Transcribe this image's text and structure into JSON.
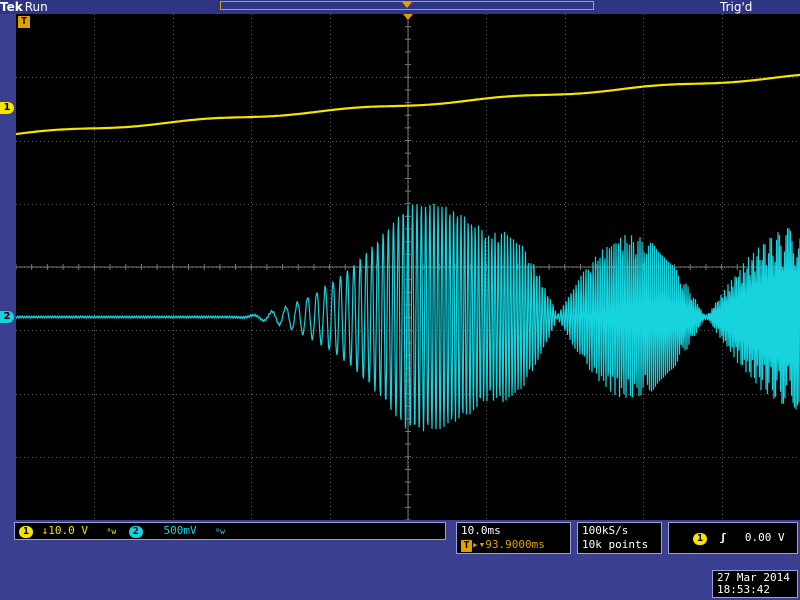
{
  "header": {
    "brand": "Tek",
    "state": "Run",
    "trigger_status": "Trig'd"
  },
  "markers": {
    "trigger_marker": "T",
    "ch1_marker": "1",
    "ch2_marker": "2"
  },
  "channels": {
    "ch1": {
      "label": "1",
      "scale": "↓10.0 V",
      "color": "#f4e400"
    },
    "ch2": {
      "label": "2",
      "scale": "500mV",
      "color": "#16d3de"
    }
  },
  "timebase": {
    "scale": "10.0ms",
    "trigger_icon": "T",
    "position": "▸▾93.9000ms"
  },
  "acquisition": {
    "rate": "100kS/s",
    "record_length": "10k points"
  },
  "trigger": {
    "source": "1",
    "slope_icon": "rising-edge-icon",
    "slope_glyph": "ʃ",
    "level": "0.00 V"
  },
  "datetime": {
    "date": "27 Mar  2014",
    "time": "18:53:42"
  },
  "colors": {
    "screen": "#000000",
    "frame": "#3a3f8f",
    "ch1": "#f4e400",
    "ch2": "#16d3de",
    "accent": "#e0a000",
    "grid": "#5a5a5a"
  }
}
